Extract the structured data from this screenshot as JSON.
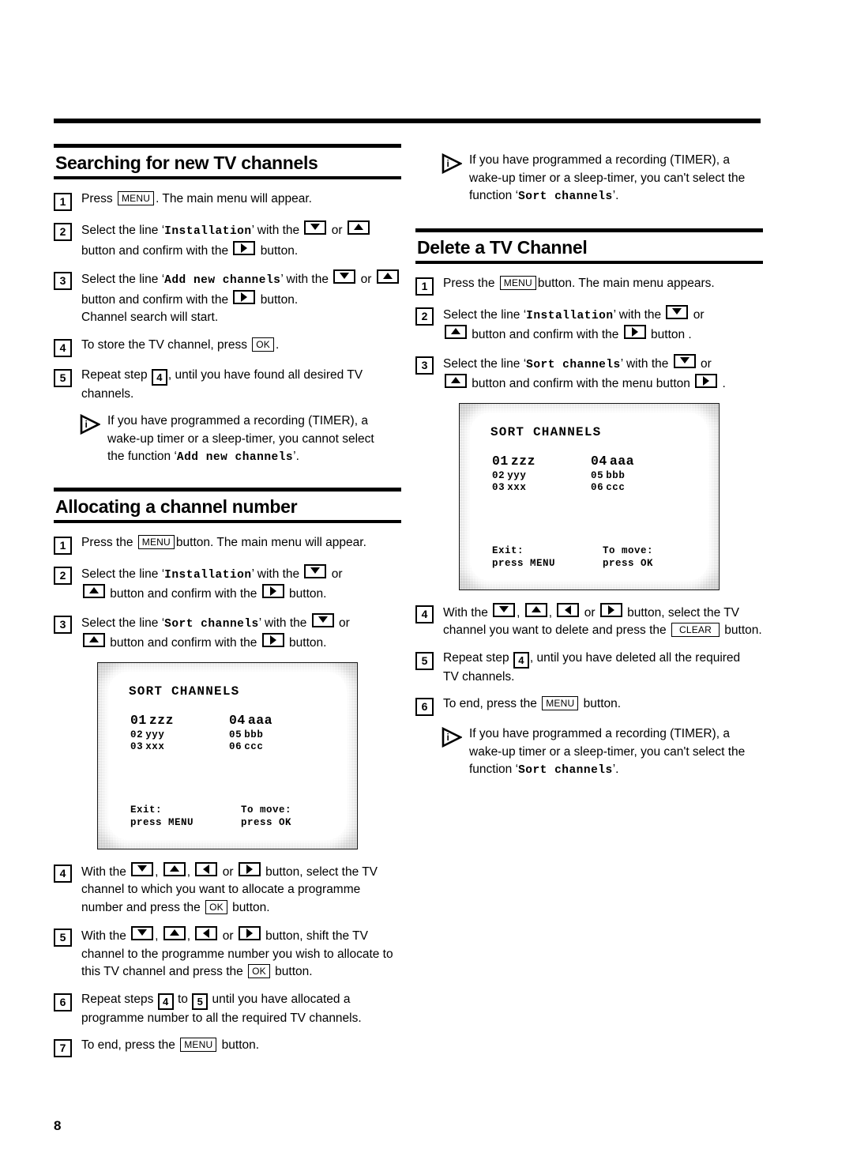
{
  "page": {
    "number": "8"
  },
  "icons": {
    "info": "info-triangle-icon",
    "arrow_down": "arrow-down-icon",
    "arrow_up": "arrow-up-icon",
    "arrow_left": "arrow-left-icon",
    "arrow_right": "arrow-right-icon"
  },
  "keys": {
    "menu": "MENU",
    "ok": "OK",
    "clear": "CLEAR"
  },
  "functions": {
    "installation": "Installation",
    "add_new_channels": "Add new channels",
    "sort_channels": "Sort channels"
  },
  "sections": {
    "searching": {
      "title": "Searching for new TV channels",
      "steps": {
        "s1": {
          "num": "1",
          "a": "Press",
          "b": ". The main menu will appear."
        },
        "s2": {
          "num": "2",
          "a": "Select the line ",
          "b": " with the ",
          "c": " or",
          "d": " button and confirm with the ",
          "e": " button."
        },
        "s3": {
          "num": "3",
          "a": "Select the line ",
          "b": " with the",
          "c": " or ",
          "d": " button and confirm with the ",
          "e": " button.",
          "f": "Channel search will start."
        },
        "s4": {
          "num": "4",
          "a": "To store the TV channel, press ",
          "b": "."
        },
        "s5": {
          "num": "5",
          "a": "Repeat step ",
          "b": ",  until you have found all desired TV",
          "c": "channels."
        }
      },
      "note": {
        "a": "If you have programmed a recording (TIMER), a",
        "b": "wake-up timer or a sleep-timer, you cannot select",
        "c": "the function "
      }
    },
    "allocating": {
      "title": "Allocating a channel number",
      "steps": {
        "s1": {
          "num": "1",
          "a": "Press the ",
          "b": "button. The main menu will appear."
        },
        "s2": {
          "num": "2",
          "a": "Select the line ",
          "b": " with the ",
          "c": " or",
          "d": " button and confirm with the ",
          "e": " button."
        },
        "s3": {
          "num": "3",
          "a": "Select the line ",
          "b": " with the ",
          "c": " or",
          "d": " button and confirm with the ",
          "e": " button."
        },
        "s4": {
          "num": "4",
          "a": "With the ",
          "b": ",",
          "c": ",",
          "d": " or ",
          "e": " button, select the TV",
          "f": "channel to which you want to allocate a programme",
          "g": "number and press the ",
          "h": " button."
        },
        "s5": {
          "num": "5",
          "a": "With the ",
          "b": ",",
          "c": ",",
          "d": " or ",
          "e": " button, shift the TV",
          "f": "channel to the programme number you wish to allocate to",
          "g": "this TV channel and press the ",
          "h": " button."
        },
        "s6": {
          "num": "6",
          "a": "Repeat steps ",
          "b": " to ",
          "c": " until you have allocated a",
          "d": "programme number to all the required TV channels.",
          "ref1": "4",
          "ref2": "5"
        },
        "s7": {
          "num": "7",
          "a": "To end, press the ",
          "b": " button."
        }
      }
    },
    "delete": {
      "title": "Delete a TV Channel",
      "note_top": {
        "a": "If you have programmed a recording (TIMER), a",
        "b": "wake-up timer or a sleep-timer, you can't select the",
        "c": "function "
      },
      "steps": {
        "s1": {
          "num": "1",
          "a": "Press the ",
          "b": "button. The main menu appears."
        },
        "s2": {
          "num": "2",
          "a": "Select the line ",
          "b": " with the ",
          "c": " or",
          "d": " button and confirm with the ",
          "e": " button ."
        },
        "s3": {
          "num": "3",
          "a": "Select the line ",
          "b": " with the ",
          "c": " or",
          "d": " button and confirm with the menu button ",
          "e": " ."
        },
        "s4": {
          "num": "4",
          "a": "With the ",
          "b": ",",
          "c": ",",
          "d": " or ",
          "e": " button, select the TV",
          "f": "channel you want to delete and press the ",
          "g": " button."
        },
        "s5": {
          "num": "5",
          "a": "Repeat step ",
          "b": ",  until you have deleted all the required",
          "c": "TV channels."
        },
        "s6": {
          "num": "6",
          "a": "To end, press the ",
          "b": " button."
        }
      },
      "note_bottom": {
        "a": "If you have programmed a recording (TIMER), a",
        "b": "wake-up timer or a sleep-timer, you can't select the",
        "c": "function "
      }
    }
  },
  "tv_screen": {
    "title": "SORT CHANNELS",
    "column_a": [
      {
        "num": "01",
        "name": "zzz"
      },
      {
        "num": "02",
        "name": "yyy"
      },
      {
        "num": "03",
        "name": "xxx"
      }
    ],
    "column_b": [
      {
        "num": "04",
        "name": "aaa"
      },
      {
        "num": "05",
        "name": "bbb"
      },
      {
        "num": "06",
        "name": "ccc"
      }
    ],
    "footer": {
      "exit_label": "Exit:",
      "exit_value": "press MENU",
      "move_label": "To move:",
      "move_value": "press OK"
    }
  }
}
